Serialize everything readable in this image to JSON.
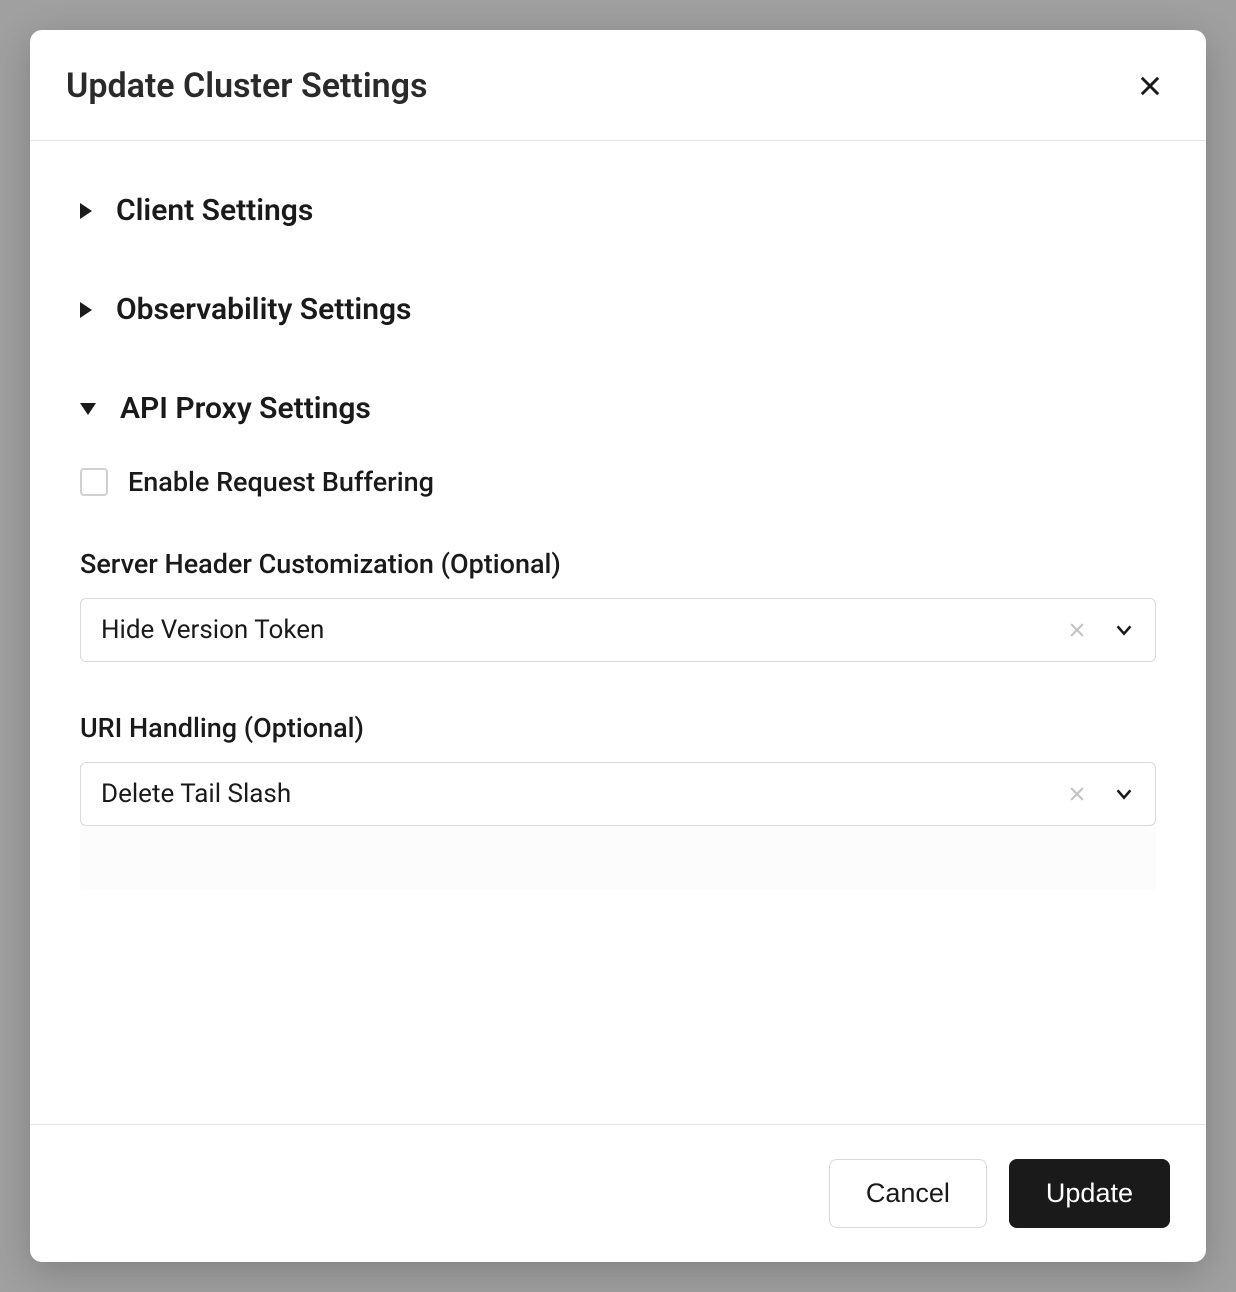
{
  "modal": {
    "title": "Update Cluster Settings",
    "sections": {
      "client": {
        "title": "Client Settings"
      },
      "observability": {
        "title": "Observability Settings"
      },
      "apiProxy": {
        "title": "API Proxy Settings",
        "enableBuffering": {
          "label": "Enable Request Buffering",
          "checked": false
        },
        "serverHeader": {
          "label": "Server Header Customization (Optional)",
          "value": "Hide Version Token"
        },
        "uriHandling": {
          "label": "URI Handling (Optional)",
          "value": "Delete Tail Slash"
        }
      }
    },
    "footer": {
      "cancel": "Cancel",
      "update": "Update"
    }
  }
}
